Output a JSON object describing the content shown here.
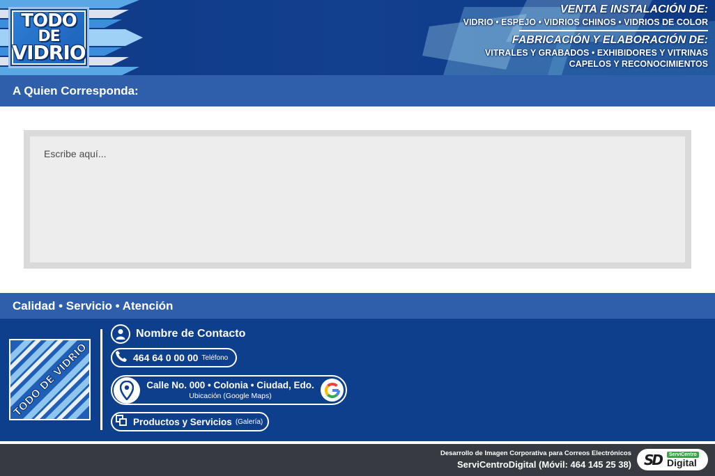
{
  "header": {
    "logo_lines": [
      "TODO",
      "DE",
      "VIDRIO"
    ],
    "sale_heading": "VENTA E INSTALACIÓN DE:",
    "sale_items": "VIDRIO • ESPEJO • VIDRIOS CHINOS • VIDRIOS DE COLOR",
    "fab_heading": "FABRICACIÓN Y ELABORACIÓN DE:",
    "fab_items_1": "VITRALES Y GRABADOS • EXHIBIDORES Y VITRINAS",
    "fab_items_2": "CAPELOS Y RECONOCIMIENTOS"
  },
  "greeting": "A Quien Corresponda:",
  "message": {
    "placeholder": "Escribe aquí...",
    "value": ""
  },
  "slogan": "Calidad • Servicio • Atención",
  "contact": {
    "footer_logo_text": "TODO DE VIDRIO",
    "name": "Nombre de Contacto",
    "phone_number": "464 64 0 00 00",
    "phone_label": "Teléfono",
    "address": "Calle No. 000 • Colonia • Ciudad, Edo.",
    "address_label": "Ubicación (Google Maps)",
    "products": "Productos y Servicios",
    "products_label": "(Galería)"
  },
  "footer": {
    "credit_line": "Desarrollo de Imagen Corporativa para Correos Electrónicos",
    "credit_main": "ServiCentroDigital (Móvil: 464 145 25 38)",
    "badge_mark": "SD",
    "badge_small": "ServiCentro",
    "badge_big": "Digital"
  },
  "icons": {
    "user": "user-icon",
    "phone": "phone-icon",
    "location": "location-pin-icon",
    "google": "google-icon",
    "gallery": "gallery-icon"
  },
  "colors": {
    "navy": "#0e3f8c",
    "bar_blue": "#2f5faa",
    "dark_footer": "#373a40",
    "badge_green": "#3ba549"
  }
}
